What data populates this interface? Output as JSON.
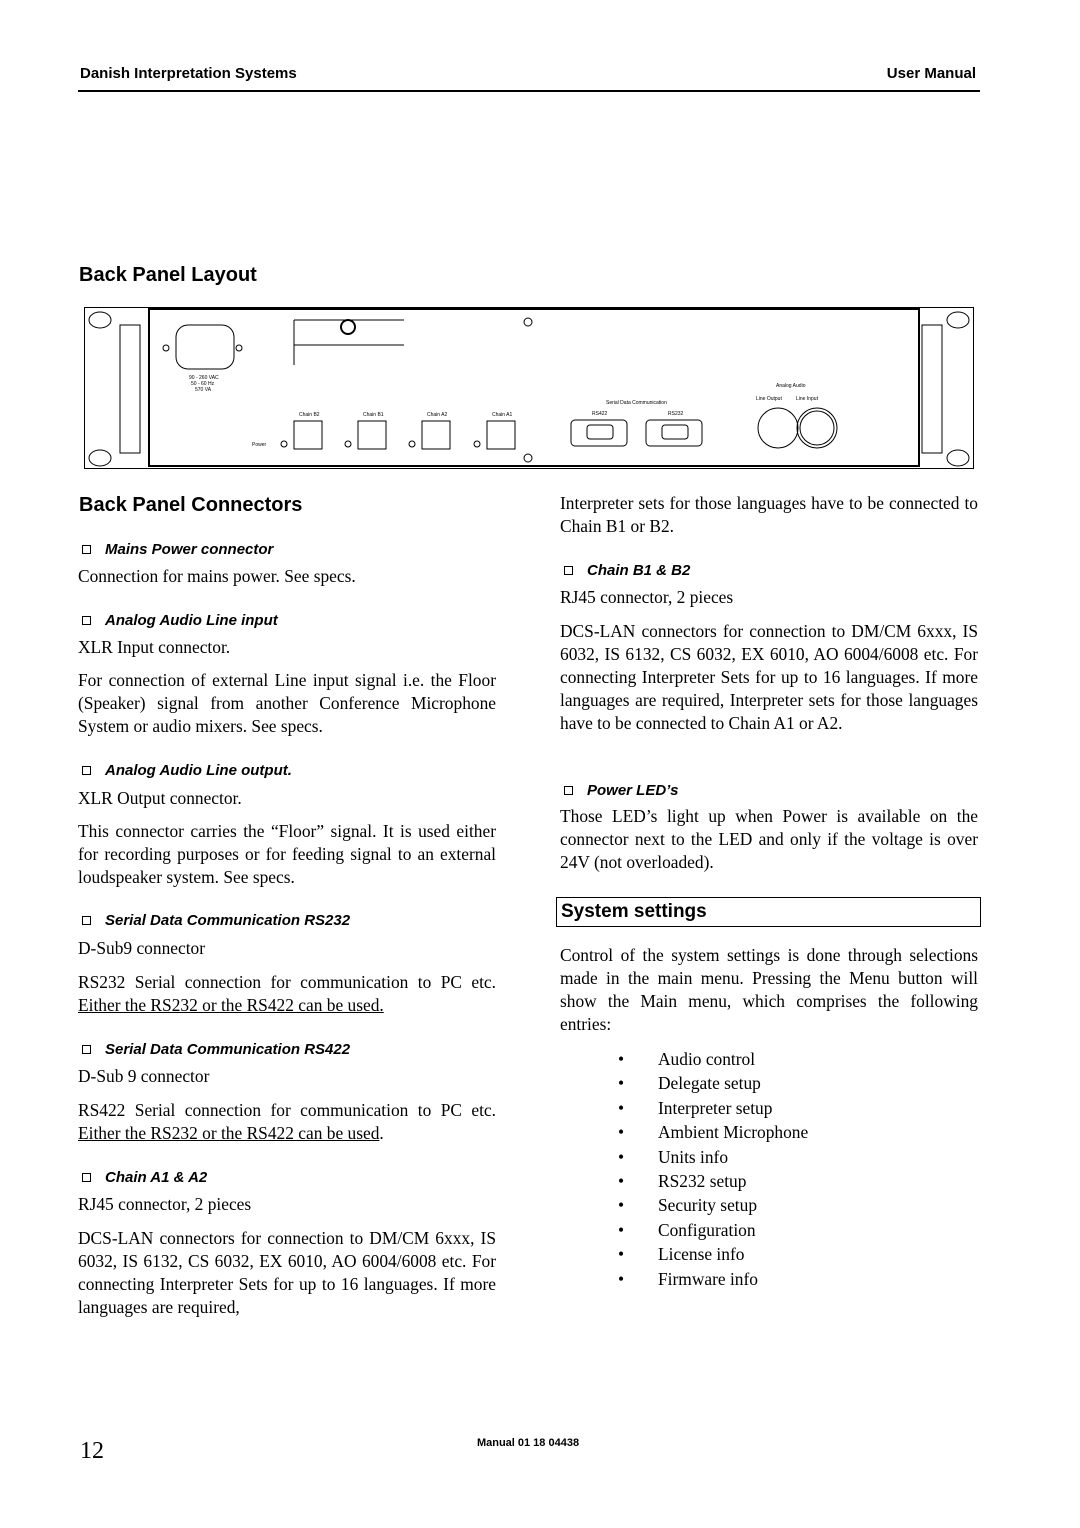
{
  "header": {
    "left": "Danish Interpretation Systems",
    "right": "User Manual"
  },
  "layout_heading": "Back Panel Layout",
  "panel": {
    "power_spec": [
      "90 - 260 VAC",
      "50 - 60 Hz",
      "570 VA"
    ],
    "chains": [
      "Chain B2",
      "Chain B1",
      "Chain A2",
      "Chain A1"
    ],
    "power_label": "Power",
    "serial_title": "Serial Data Communication",
    "serial_ports": [
      "RS422",
      "RS232"
    ],
    "audio_title": "Analog Audio",
    "audio_ports": [
      "Line Output",
      "Line Input"
    ]
  },
  "connectors_heading": "Back Panel Connectors",
  "left": {
    "mains": {
      "title": "Mains Power connector",
      "text": "Connection for mains power. See specs."
    },
    "line_in": {
      "title": "Analog Audio Line input",
      "text1": "XLR Input connector.",
      "text2": "For connection of external Line input signal i.e. the Floor (Speaker) signal from another Conference Microphone System or audio mixers. See specs."
    },
    "line_out": {
      "title": "Analog Audio Line output.",
      "text1": "XLR Output connector.",
      "text2": "This connector carries the “Floor” signal. It is used either for recording purposes or for feeding signal to an external loudspeaker system. See specs."
    },
    "rs232": {
      "title": "Serial Data Communication RS232",
      "text1": "D-Sub9 connector",
      "text2a": "RS232 Serial connection for communication to PC etc. ",
      "text2b": "Either the RS232 or the RS422 can be used."
    },
    "rs422": {
      "title": "Serial Data Communication RS422",
      "text1": "D-Sub 9 connector",
      "text2a": "RS422 Serial connection for communication to PC etc. ",
      "text2b": "Either the RS232 or the RS422 can be used",
      "text2c": "."
    },
    "chain_a": {
      "title": "Chain A1 & A2",
      "text1": "RJ45 connector, 2 pieces",
      "text2": "DCS-LAN connectors for connection to DM/CM 6xxx, IS 6032, IS 6132, CS 6032, EX 6010, AO 6004/6008 etc. For connecting Interpreter Sets for up to 16 languages. If more languages are required,"
    }
  },
  "right": {
    "cont": "Interpreter sets for those languages have to be connected to Chain B1 or B2.",
    "chain_b": {
      "title": "Chain B1 & B2",
      "text1": "RJ45 connector, 2 pieces",
      "text2": "DCS-LAN connectors for connection to DM/CM 6xxx, IS 6032, IS 6132, CS 6032, EX 6010, AO 6004/6008 etc. For connecting Interpreter Sets for up to 16 languages. If more languages are required, Interpreter sets for those languages have to be connected to Chain A1 or A2."
    },
    "leds": {
      "title": "Power LED’s",
      "text": "Those LED’s light up when Power is available on the connector next to the LED and only if the voltage is over 24V (not overloaded)."
    },
    "system_heading": "System settings",
    "system_text": "Control of the system settings is done through selections made in the main menu. Pressing the Menu button will show the Main menu, which comprises the following entries:",
    "menu_entries": [
      "Audio control",
      "Delegate setup",
      "Interpreter setup",
      "Ambient Microphone",
      "Units info",
      "RS232 setup",
      "Security setup",
      "Configuration",
      "License info",
      "Firmware info"
    ]
  },
  "footer": {
    "page_number": "12",
    "manual": "Manual 01 18 04438"
  }
}
